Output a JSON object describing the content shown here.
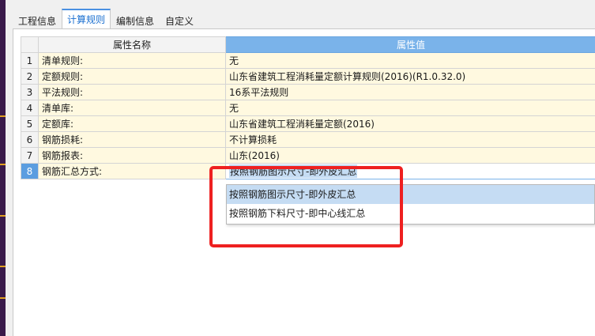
{
  "tabs": [
    {
      "label": "工程信息",
      "active": false
    },
    {
      "label": "计算规则",
      "active": true
    },
    {
      "label": "编制信息",
      "active": false
    },
    {
      "label": "自定义",
      "active": false
    }
  ],
  "table": {
    "headers": {
      "name": "属性名称",
      "value": "属性值"
    },
    "rows": [
      {
        "index": "1",
        "name": "清单规则:",
        "value": "无"
      },
      {
        "index": "2",
        "name": "定额规则:",
        "value": "山东省建筑工程消耗量定额计算规则(2016)(R1.0.32.0)"
      },
      {
        "index": "3",
        "name": "平法规则:",
        "value": "16系平法规则"
      },
      {
        "index": "4",
        "name": "清单库:",
        "value": "无"
      },
      {
        "index": "5",
        "name": "定额库:",
        "value": "山东省建筑工程消耗量定额(2016)"
      },
      {
        "index": "6",
        "name": "钢筋损耗:",
        "value": "不计算损耗"
      },
      {
        "index": "7",
        "name": "钢筋报表:",
        "value": "山东(2016)"
      },
      {
        "index": "8",
        "name": "钢筋汇总方式:",
        "value": "按照钢筋图示尺寸-即外皮汇总"
      }
    ]
  },
  "dropdown": {
    "options": [
      {
        "label": "按照钢筋图示尺寸-即外皮汇总",
        "selected": true
      },
      {
        "label": "按照钢筋下料尺寸-即中心线汇总",
        "selected": false
      }
    ]
  },
  "colors": {
    "header_accent": "#7ab3ea",
    "row_background": "#fff9e0",
    "selection": "#c5dcf3",
    "annotation_box": "#ee2020"
  }
}
